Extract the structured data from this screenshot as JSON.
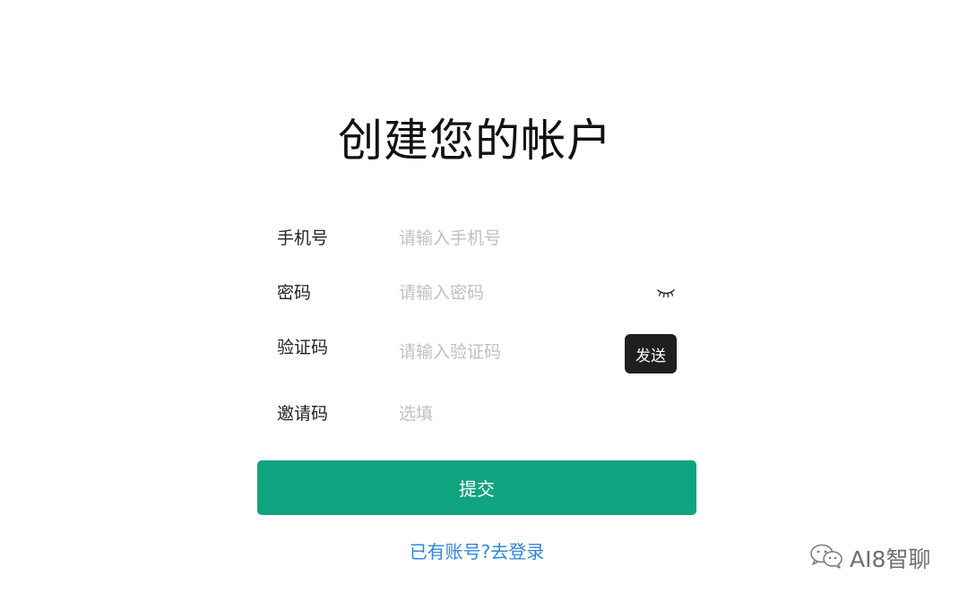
{
  "page": {
    "title": "创建您的帐户"
  },
  "form": {
    "phone": {
      "label": "手机号",
      "placeholder": "请输入手机号"
    },
    "password": {
      "label": "密码",
      "placeholder": "请输入密码",
      "visibility_icon": "eye-closed-icon"
    },
    "code": {
      "label": "验证码",
      "placeholder": "请输入验证码",
      "send_label": "发送"
    },
    "invite": {
      "label": "邀请码",
      "placeholder": "选填"
    },
    "submit_label": "提交",
    "login_link": "已有账号?去登录"
  },
  "watermark": {
    "icon": "wechat-icon",
    "text": "AI8智聊"
  },
  "colors": {
    "primary": "#10a37f",
    "link": "#2e86de",
    "send_button": "#1f1f1f",
    "placeholder": "#c0c0c0"
  }
}
